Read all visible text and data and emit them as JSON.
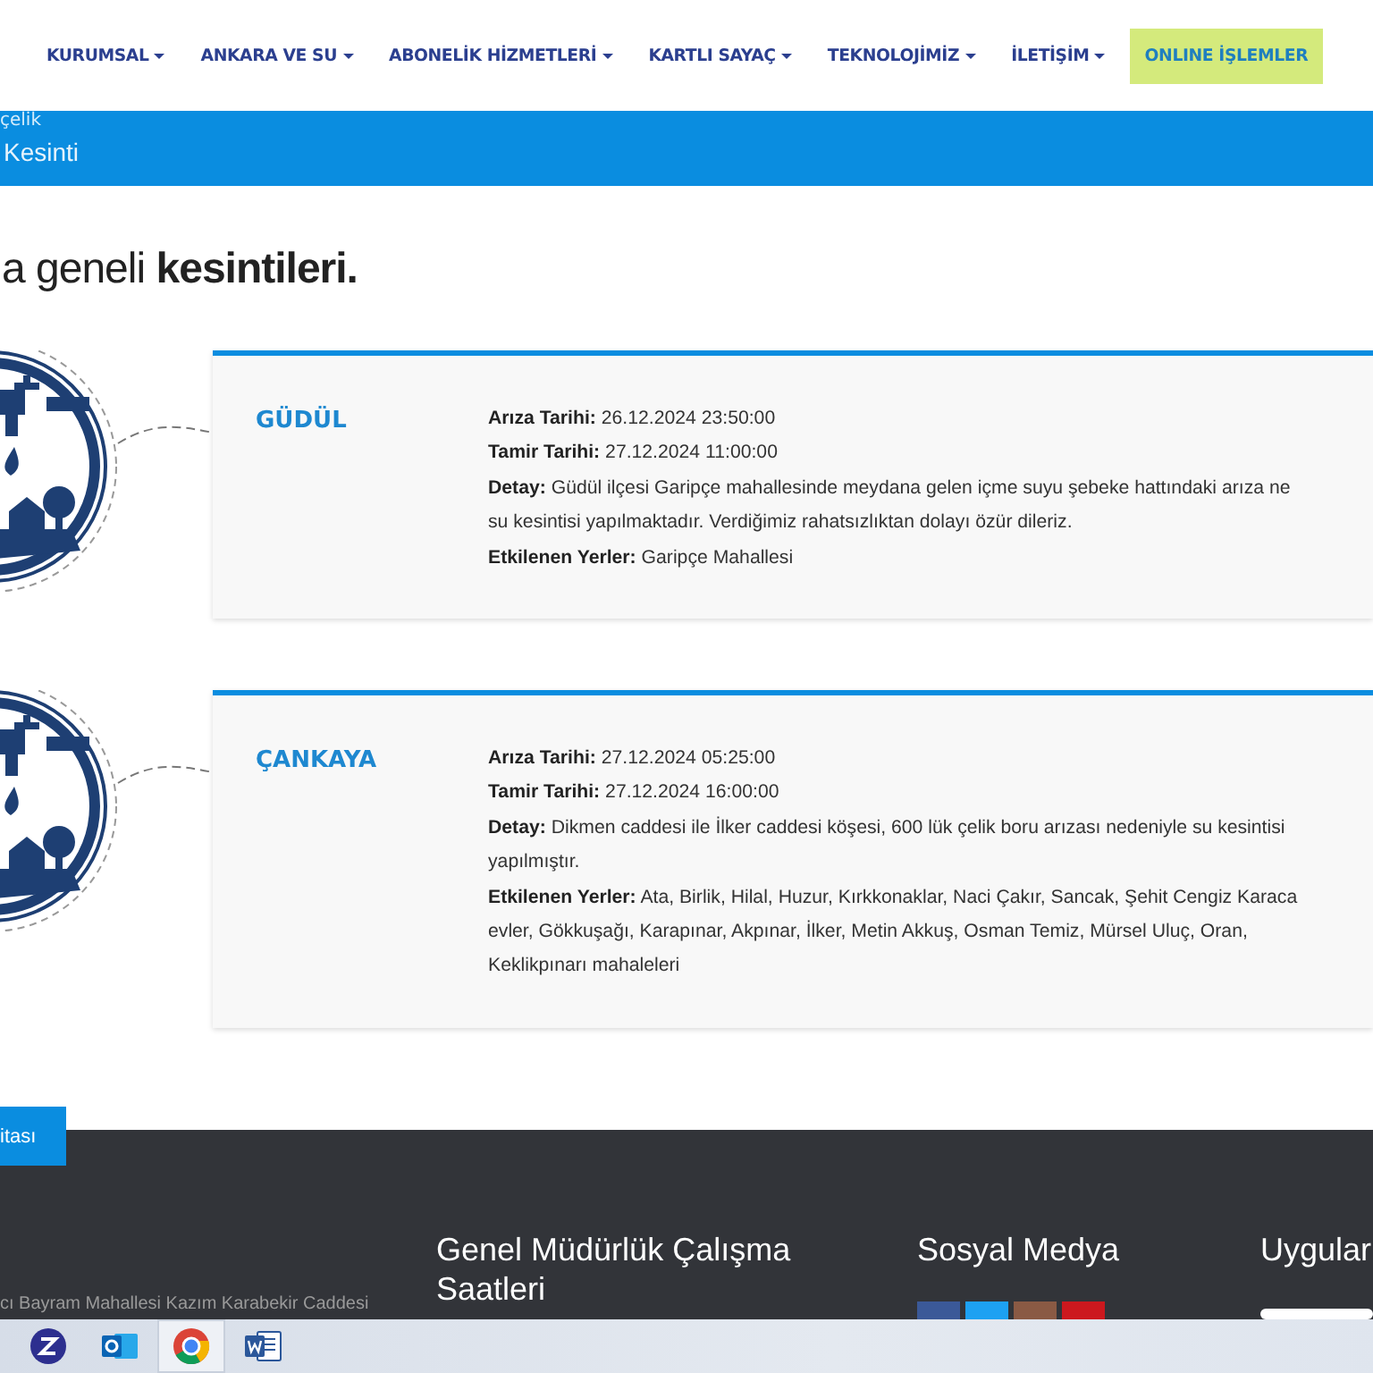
{
  "nav": {
    "items": [
      {
        "label": "KURUMSAL",
        "kind": "dropdown"
      },
      {
        "label": "ANKARA VE SU",
        "kind": "dropdown"
      },
      {
        "label": "ABONELİK HİZMETLERİ",
        "kind": "dropdown"
      },
      {
        "label": "KARTLI SAYAÇ",
        "kind": "dropdown"
      },
      {
        "label": "TEKNOLOJİMİZ",
        "kind": "dropdown"
      },
      {
        "label": "İLETİŞİM",
        "kind": "dropdown"
      },
      {
        "label": "ONLINE İŞLEMLER",
        "kind": "button"
      }
    ]
  },
  "banner": {
    "breadcrumb": "çelik",
    "title": "Kesinti"
  },
  "heading": "a geneli **kesintileri.**",
  "outages": [
    {
      "district": "GÜDÜL",
      "fields": [
        {
          "label": "Arıza Tarihi:",
          "lines": [
            "26.12.2024 23:50:00"
          ]
        },
        {
          "label": "Tamir Tarihi:",
          "lines": [
            "27.12.2024 11:00:00"
          ]
        },
        {
          "label": "Detay:",
          "lines": [
            "Güdül ilçesi Garipçe mahallesinde meydana gelen içme suyu şebeke hattındaki arıza ne",
            "su kesintisi yapılmaktadır. Verdiğimiz rahatsızlıktan dolayı özür dileriz."
          ]
        },
        {
          "label": "Etkilenen Yerler:",
          "lines": [
            "Garipçe Mahallesi"
          ]
        }
      ]
    },
    {
      "district": "ÇANKAYA",
      "fields": [
        {
          "label": "Arıza Tarihi:",
          "lines": [
            "27.12.2024 05:25:00"
          ]
        },
        {
          "label": "Tamir Tarihi:",
          "lines": [
            "27.12.2024 16:00:00"
          ]
        },
        {
          "label": "Detay:",
          "lines": [
            "Dikmen caddesi ile İlker caddesi köşesi, 600 lük çelik boru arızası nedeniyle su kesintisi",
            "yapılmıştır."
          ]
        },
        {
          "label": "Etkilenen Yerler:",
          "lines": [
            "Ata, Birlik, Hilal, Huzur, Kırkkonaklar, Naci Çakır, Sancak, Şehit Cengiz Karaca",
            "evler, Gökkuşağı, Karapınar, Akpınar, İlker, Metin Akkuş, Osman Temiz, Mürsel Uluç, Oran,",
            "Keklikpınarı mahaleleri"
          ]
        }
      ]
    }
  ],
  "map_button": "itası",
  "footer": {
    "address": "cı Bayram Mahallesi Kazım Karabekir Caddesi",
    "columns": [
      "Genel Müdürlük Çalışma Saatleri",
      "Sosyal Medya",
      "Uygular"
    ]
  },
  "taskbar": {
    "apps": [
      {
        "kind": "chat",
        "selected": false
      },
      {
        "kind": "mail",
        "selected": false
      },
      {
        "kind": "browser",
        "selected": true
      },
      {
        "kind": "document",
        "selected": false
      }
    ]
  }
}
